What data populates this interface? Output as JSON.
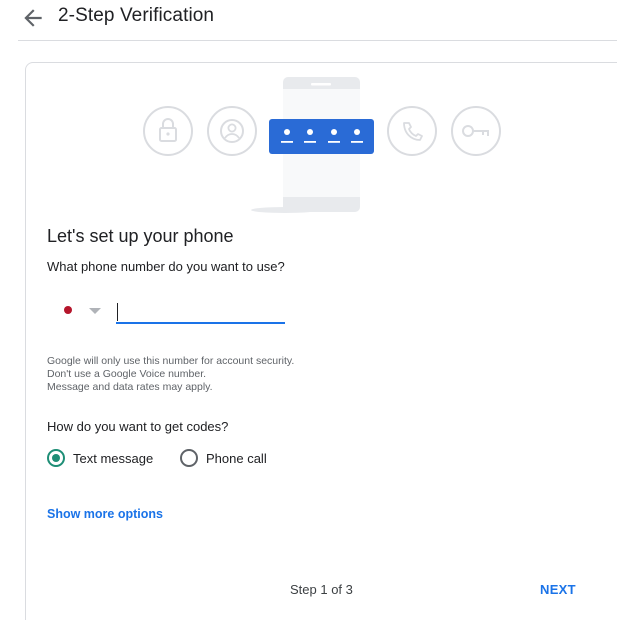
{
  "header": {
    "back_icon": "arrow-back-icon",
    "title": "2-Step Verification"
  },
  "illustration": {
    "icons": [
      "lock-icon",
      "account-circle-icon",
      "phone-icon",
      "key-icon"
    ],
    "phone_screen_icon": "password-dots-icon",
    "accent": "#2a6bd6"
  },
  "form": {
    "title": "Let's set up your phone",
    "question": "What phone number do you want to use?",
    "country_flag_color": "#b5152b",
    "phone_value": "",
    "note_lines": [
      "Google will only use this number for account security.",
      "Don't use a Google Voice number.",
      "Message and data rates may apply."
    ],
    "codes_question": "How do you want to get codes?",
    "options": [
      {
        "label": "Text message",
        "checked": true
      },
      {
        "label": "Phone call",
        "checked": false
      }
    ],
    "more_options": "Show more options"
  },
  "footer": {
    "step": "Step 1 of 3",
    "next": "NEXT"
  },
  "colors": {
    "link": "#1a73e8",
    "radio_checked": "#1e8e76"
  }
}
